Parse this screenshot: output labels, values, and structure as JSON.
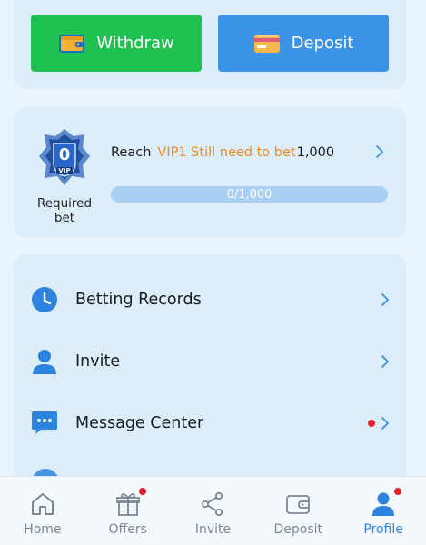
{
  "actions": {
    "withdraw_label": "Withdraw",
    "deposit_label": "Deposit"
  },
  "vip": {
    "badge_level": "0",
    "badge_tag": "VIP",
    "required_label": "Required bet",
    "reach_prefix": "Reach",
    "reach_highlight": "VIP1 Still need to bet",
    "reach_amount": "1,000",
    "progress_text": "0/1,000",
    "progress_fraction": 0
  },
  "menu": {
    "items": [
      {
        "label": "Betting Records",
        "icon": "clock-icon",
        "badge": false
      },
      {
        "label": "Invite",
        "icon": "person-icon",
        "badge": false
      },
      {
        "label": "Message Center",
        "icon": "chat-icon",
        "badge": true
      }
    ]
  },
  "nav": {
    "items": [
      {
        "label": "Home",
        "icon": "home-icon",
        "active": false,
        "badge": false
      },
      {
        "label": "Offers",
        "icon": "gift-icon",
        "active": false,
        "badge": true
      },
      {
        "label": "Invite",
        "icon": "share-icon",
        "active": false,
        "badge": false
      },
      {
        "label": "Deposit",
        "icon": "wallet-icon",
        "active": false,
        "badge": false
      },
      {
        "label": "Profile",
        "icon": "profile-icon",
        "active": true,
        "badge": true
      }
    ]
  },
  "colors": {
    "withdraw": "#1fc14f",
    "deposit": "#3b93e8",
    "highlight": "#f08a1a",
    "active_nav": "#2c84de",
    "badge_dot": "#e8202a"
  }
}
